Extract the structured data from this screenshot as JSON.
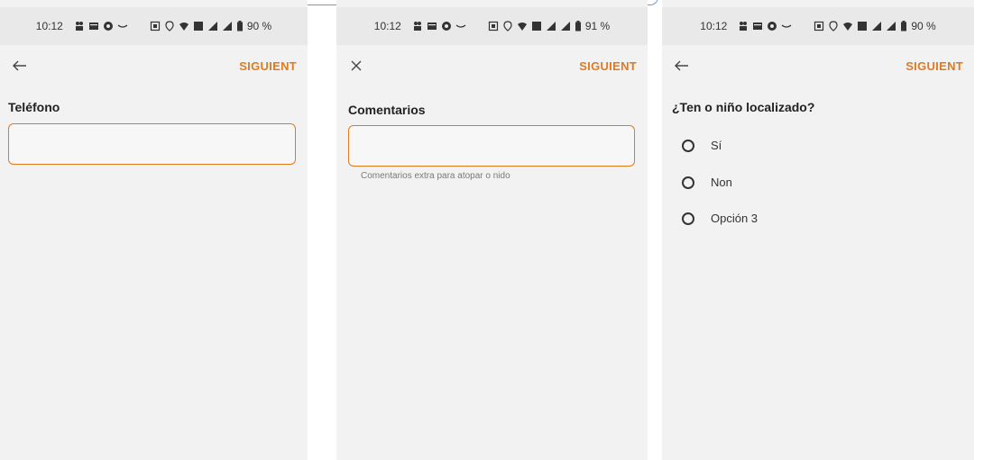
{
  "status": {
    "s1_time": "10:12",
    "s1_battery": "90 %",
    "s2_time": "10:12",
    "s2_battery": "91 %",
    "s3_time": "10:12",
    "s3_battery": "90 %"
  },
  "screen1": {
    "next_label": "SIGUIENT",
    "field_label": "Teléfono",
    "field_value": ""
  },
  "screen2": {
    "next_label": "SIGUIENT",
    "field_label": "Comentarios",
    "field_value": "",
    "hint": "Comentarios extra para atopar o nido"
  },
  "screen3": {
    "next_label": "SIGUIENT",
    "question": "¿Ten o niño localizado?",
    "options": [
      {
        "label": "Sí",
        "selected": false
      },
      {
        "label": "Non",
        "selected": false
      },
      {
        "label": "Opción 3",
        "selected": false
      }
    ]
  },
  "colors": {
    "accent": "#e07a1f",
    "screen_bg": "#f2f2f2",
    "statusbar_bg": "#e9e9e9",
    "tab_border": "#6b9bd6"
  },
  "icons": [
    "back-arrow-icon",
    "close-icon",
    "radio-unchecked-icon",
    "wifi-icon",
    "signal-icon",
    "battery-icon",
    "location-icon"
  ]
}
